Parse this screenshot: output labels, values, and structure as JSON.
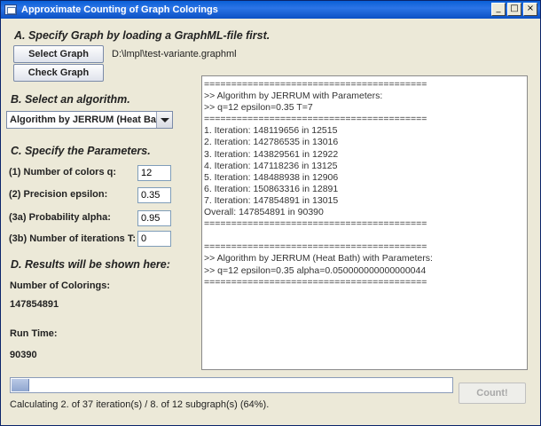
{
  "window": {
    "title": "Approximate Counting of Graph Colorings",
    "controls": [
      "_",
      "□",
      "×"
    ]
  },
  "sectionA": {
    "heading": "A. Specify Graph by loading a GraphML-file first.",
    "select_graph_label": "Select Graph",
    "check_graph_label": "Check Graph",
    "file_path": "D:\\lmpl\\test-variante.graphml"
  },
  "sectionB": {
    "heading": "B. Select an algorithm.",
    "algorithm_selected": "Algorithm by JERRUM (Heat Bath)"
  },
  "sectionC": {
    "heading": "C. Specify the Parameters.",
    "params": [
      {
        "label": "(1) Number of colors q:",
        "value": "12"
      },
      {
        "label": "(2) Precision epsilon:",
        "value": "0.35"
      },
      {
        "label": "(3a) Probability alpha:",
        "value": "0.95"
      },
      {
        "label": "(3b) Number of iterations T:",
        "value": "0"
      }
    ]
  },
  "sectionD": {
    "heading": "D. Results will be shown here:",
    "colorings_label": "Number of Colorings:",
    "colorings_value": "147854891",
    "runtime_label": "Run Time:",
    "runtime_value": "90390"
  },
  "log_lines": [
    "=========================================",
    ">> Algorithm by JERRUM with Parameters:",
    ">> q=12  epsilon=0.35  T=7",
    "=========================================",
    "1. Iteration: 148119656 in 12515",
    "2. Iteration: 142786535 in 13016",
    "3. Iteration: 143829561 in 12922",
    "4. Iteration: 147118236 in 13125",
    "5. Iteration: 148488938 in 12906",
    "6. Iteration: 150863316 in 12891",
    "7. Iteration: 147854891 in 13015",
    "Overall: 147854891 in 90390",
    "=========================================",
    "",
    "=========================================",
    ">> Algorithm by JERRUM (Heat Bath) with Parameters:",
    ">> q=12  epsilon=0.35  alpha=0.050000000000000044",
    "========================================="
  ],
  "progress": {
    "fraction": 0.04
  },
  "count_button_label": "Count!",
  "status_text": "Calculating 2. of 37 iteration(s) / 8. of 12 subgraph(s) (64%)."
}
